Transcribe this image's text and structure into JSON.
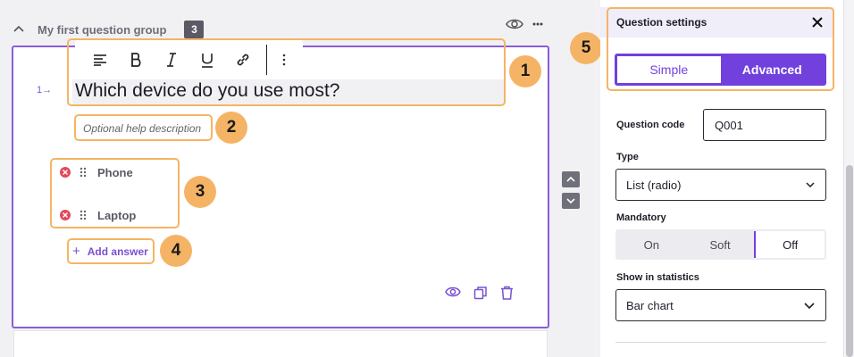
{
  "group": {
    "title": "My first question group",
    "count": "3"
  },
  "question": {
    "number": "1",
    "text": "Which device do you use most?",
    "help_placeholder": "Optional help description",
    "answers": [
      {
        "label": "Phone"
      },
      {
        "label": "Laptop"
      }
    ],
    "add_answer_label": "Add answer"
  },
  "callouts": [
    "1",
    "2",
    "3",
    "4",
    "5"
  ],
  "panel": {
    "title": "Question settings",
    "modes": {
      "simple": "Simple",
      "advanced": "Advanced",
      "selected": "Simple"
    },
    "code_label": "Question code",
    "code_value": "Q001",
    "type_label": "Type",
    "type_value": "List (radio)",
    "mandatory_label": "Mandatory",
    "mandatory_options": [
      "On",
      "Soft",
      "Off"
    ],
    "mandatory_selected": "Off",
    "stats_label": "Show in statistics",
    "stats_value": "Bar chart"
  },
  "colors": {
    "accent": "#7240dd",
    "highlight": "#f5b465",
    "remove": "#e04a5a"
  }
}
